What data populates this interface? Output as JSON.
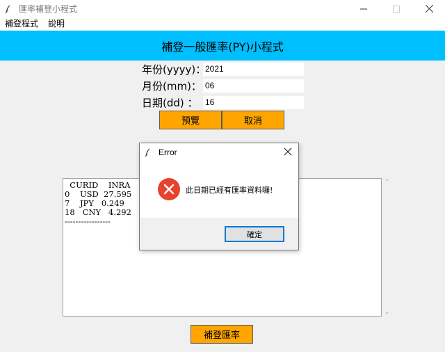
{
  "window": {
    "title": "匯率補登小程式",
    "minimize_glyph": "—",
    "maximize_glyph": "☐",
    "close_glyph": "✕"
  },
  "menubar": {
    "items": [
      {
        "label": "補登程式"
      },
      {
        "label": "說明"
      }
    ]
  },
  "banner": {
    "title": "補登一般匯率(PY)小程式",
    "color": "#00bfff"
  },
  "form": {
    "year_label": "年份(yyyy)：",
    "year_value": "2021",
    "month_label": "月份(mm)：",
    "month_value": "06",
    "day_label": "日期(dd)  ：",
    "day_value": "16"
  },
  "buttons": {
    "preview_label": "預覽",
    "cancel_label": "取消",
    "submit_label": "補登匯率",
    "color": "#ffa500"
  },
  "output": {
    "text": "  CURID    INRA\n0    USD  27.595\n7    JPY   0.249\n18   CNY   4.292\n-----------------"
  },
  "dialog": {
    "title": "Error",
    "message": "此日期已經有匯率資料囉!",
    "ok_label": "確定",
    "icon": "error-icon",
    "close_glyph": "✕"
  }
}
